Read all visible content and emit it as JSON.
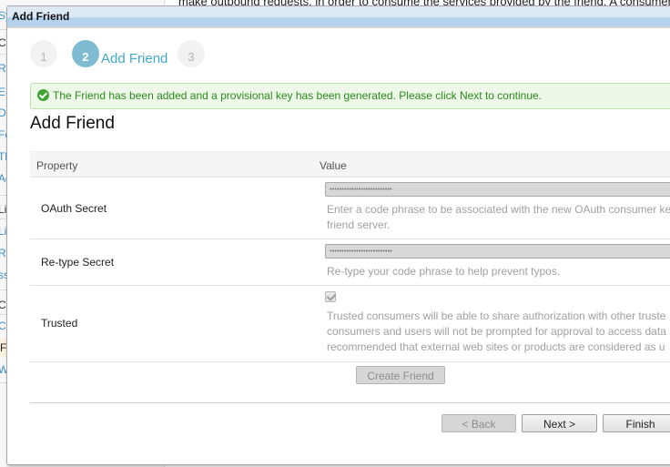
{
  "background": {
    "page_text": "make outbound requests, in order to consume the services provided by the friend. A consumer key a",
    "sidebar_items": [
      {
        "label": "Sy",
        "type": "link"
      },
      {
        "label": "Co",
        "type": "heading"
      },
      {
        "label": "Re",
        "type": "link"
      },
      {
        "label": "E-",
        "type": "link"
      },
      {
        "label": "Da",
        "type": "link"
      },
      {
        "label": "Fe",
        "type": "link"
      },
      {
        "label": "Th",
        "type": "link"
      },
      {
        "label": "Ad",
        "type": "link"
      },
      {
        "label": "Li",
        "type": "heading"
      },
      {
        "label": "Li",
        "type": "link"
      },
      {
        "label": "Re",
        "type": "link"
      },
      {
        "label": "ss",
        "type": "link"
      },
      {
        "label": "Co",
        "type": "heading"
      },
      {
        "label": "Co",
        "type": "link"
      },
      {
        "label": "Fr",
        "type": "active"
      },
      {
        "label": "W",
        "type": "link"
      }
    ]
  },
  "dialog": {
    "title": "Add Friend",
    "steps": [
      {
        "number": "1",
        "label": "",
        "active": false
      },
      {
        "number": "2",
        "label": "Add Friend",
        "active": true
      },
      {
        "number": "3",
        "label": "",
        "active": false
      }
    ],
    "alert": {
      "icon": "check-circle-icon",
      "message": "The Friend has been added and a provisional key has been generated. Please click Next to continue.",
      "color": "#2a8a1c"
    },
    "section_title": "Add Friend",
    "table": {
      "headers": [
        "Property",
        "Value"
      ],
      "rows": [
        {
          "property": "OAuth Secret",
          "value": "••••••••••••••••••••••••••",
          "help": [
            "Enter a code phrase to be associated with the new OAuth consumer ke",
            "friend server."
          ]
        },
        {
          "property": "Re-type Secret",
          "value": "••••••••••••••••••••••••••",
          "help": [
            "Re-type your code phrase to help prevent typos."
          ]
        },
        {
          "property": "Trusted",
          "checked": true,
          "help": [
            "Trusted consumers will be able to share authorization with other truste",
            "consumers and users will not be prompted for approval to access data",
            "recommended that external web sites or products are considered as u"
          ]
        }
      ]
    },
    "create_button": "Create Friend",
    "buttons": {
      "back": "< Back",
      "next": "Next >",
      "finish": "Finish"
    }
  }
}
